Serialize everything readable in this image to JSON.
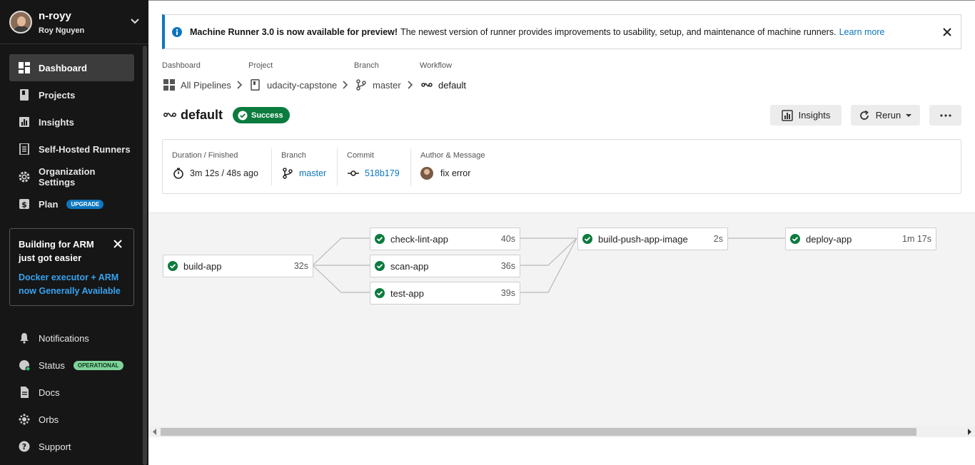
{
  "user": {
    "username": "n-royy",
    "full_name": "Roy Nguyen"
  },
  "nav": {
    "items": [
      {
        "label": "Dashboard",
        "icon": "dashboard-icon",
        "active": true
      },
      {
        "label": "Projects",
        "icon": "projects-icon"
      },
      {
        "label": "Insights",
        "icon": "insights-icon"
      },
      {
        "label": "Self-Hosted Runners",
        "icon": "runners-icon"
      },
      {
        "label": "Organization Settings",
        "icon": "gear-icon"
      },
      {
        "label": "Plan",
        "icon": "dollar-icon",
        "badge": "UPGRADE"
      }
    ],
    "bottom": [
      {
        "label": "Notifications",
        "icon": "bell-icon"
      },
      {
        "label": "Status",
        "icon": "status-icon",
        "badge": "OPERATIONAL"
      },
      {
        "label": "Docs",
        "icon": "docs-icon"
      },
      {
        "label": "Orbs",
        "icon": "orbs-icon"
      },
      {
        "label": "Support",
        "icon": "help-icon"
      }
    ]
  },
  "promo": {
    "title": "Building for ARM just got easier",
    "link": "Docker executor + ARM now Generally Available"
  },
  "banner": {
    "bold": "Machine Runner 3.0 is now available for preview!",
    "text": "The newest version of runner provides improvements to usability, setup, and maintenance of machine runners.",
    "link": "Learn more"
  },
  "breadcrumb": {
    "labels": [
      "Dashboard",
      "Project",
      "Branch",
      "Workflow"
    ],
    "values": [
      "All Pipelines",
      "udacity-capstone",
      "master",
      "default"
    ]
  },
  "workflow": {
    "name": "default",
    "status": "Success"
  },
  "actions": {
    "insights": "Insights",
    "rerun": "Rerun"
  },
  "meta": {
    "duration_label": "Duration / Finished",
    "duration_value": "3m 12s / 48s ago",
    "branch_label": "Branch",
    "branch_value": "master",
    "commit_label": "Commit",
    "commit_value": "518b179",
    "author_label": "Author & Message",
    "author_message": "fix error"
  },
  "jobs": [
    {
      "name": "build-app",
      "duration": "32s"
    },
    {
      "name": "check-lint-app",
      "duration": "40s"
    },
    {
      "name": "scan-app",
      "duration": "36s"
    },
    {
      "name": "test-app",
      "duration": "39s"
    },
    {
      "name": "build-push-app-image",
      "duration": "2s"
    },
    {
      "name": "deploy-app",
      "duration": "1m 17s"
    }
  ],
  "colors": {
    "sidebar": "#161616",
    "accent": "#0e76bd",
    "success": "#0b7b3e"
  }
}
